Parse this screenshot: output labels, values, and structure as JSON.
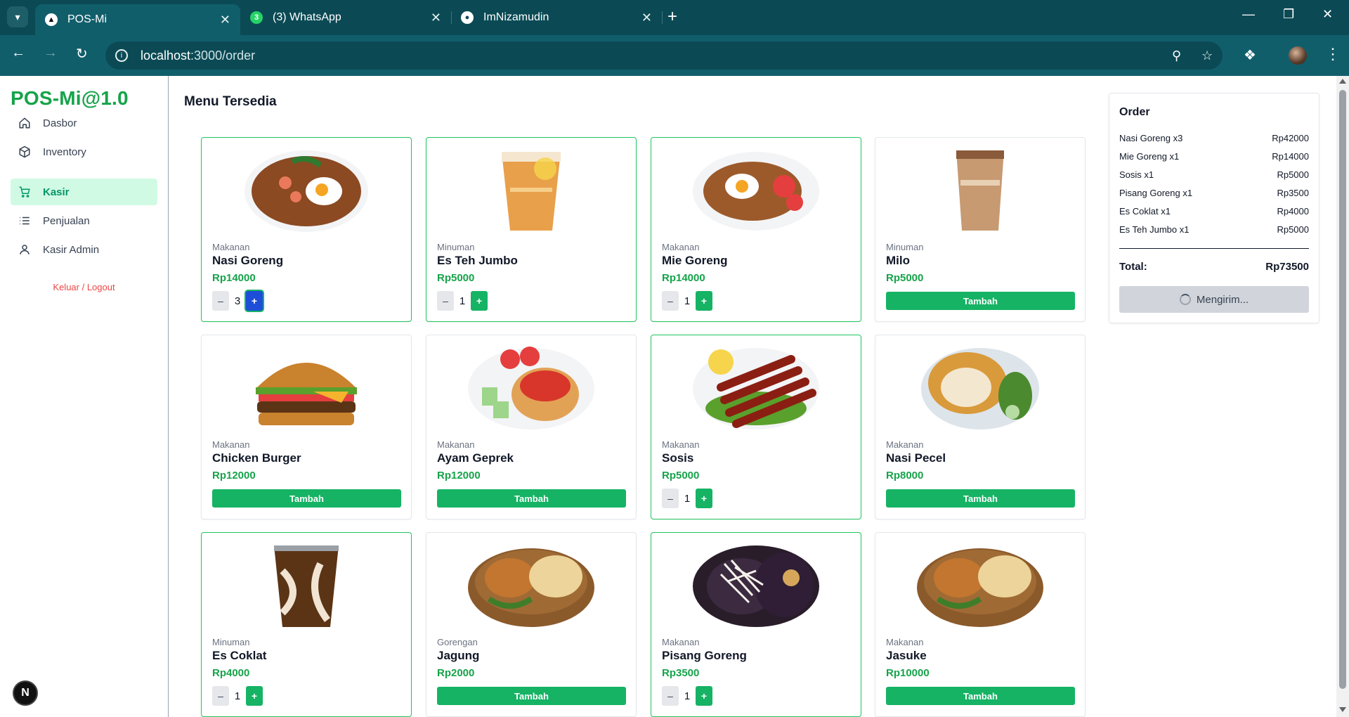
{
  "browser": {
    "tabs": [
      {
        "title": "POS-Mi",
        "icon": "nextjs-triangle-icon",
        "active": true
      },
      {
        "title": "(3) WhatsApp",
        "icon": "whatsapp-icon",
        "badge": "3",
        "active": false
      },
      {
        "title": "ImNizamudin",
        "icon": "github-icon",
        "active": false
      }
    ],
    "url_host": "localhost",
    "url_path": ":3000/order"
  },
  "sidebar": {
    "brand": "POS-Mi@1.0",
    "items": [
      {
        "label": "Dasbor",
        "icon": "home-icon",
        "active": false
      },
      {
        "label": "Inventory",
        "icon": "box-icon",
        "active": false
      },
      {
        "label": "Kasir",
        "icon": "cart-icon",
        "active": true
      },
      {
        "label": "Penjualan",
        "icon": "list-icon",
        "active": false
      },
      {
        "label": "Kasir Admin",
        "icon": "user-icon",
        "active": false
      }
    ],
    "logout": "Keluar / Logout",
    "dev_badge": "N"
  },
  "main": {
    "title": "Menu Tersedia",
    "add_label": "Tambah",
    "menu": [
      {
        "category": "Makanan",
        "name": "Nasi Goreng",
        "price": "Rp14000",
        "qty": "3",
        "selected": true,
        "img": "nasi-goreng"
      },
      {
        "category": "Minuman",
        "name": "Es Teh Jumbo",
        "price": "Rp5000",
        "qty": "1",
        "selected": true,
        "img": "es-teh"
      },
      {
        "category": "Makanan",
        "name": "Mie Goreng",
        "price": "Rp14000",
        "qty": "1",
        "selected": true,
        "img": "mie-goreng"
      },
      {
        "category": "Minuman",
        "name": "Milo",
        "price": "Rp5000",
        "qty": null,
        "selected": false,
        "img": "milo"
      },
      {
        "category": "Makanan",
        "name": "Chicken Burger",
        "price": "Rp12000",
        "qty": null,
        "selected": false,
        "img": "burger"
      },
      {
        "category": "Makanan",
        "name": "Ayam Geprek",
        "price": "Rp12000",
        "qty": null,
        "selected": false,
        "img": "ayam-geprek"
      },
      {
        "category": "Makanan",
        "name": "Sosis",
        "price": "Rp5000",
        "qty": "1",
        "selected": true,
        "img": "sosis"
      },
      {
        "category": "Makanan",
        "name": "Nasi Pecel",
        "price": "Rp8000",
        "qty": null,
        "selected": false,
        "img": "nasi-pecel"
      },
      {
        "category": "Minuman",
        "name": "Es Coklat",
        "price": "Rp4000",
        "qty": "1",
        "selected": true,
        "img": "es-coklat"
      },
      {
        "category": "Gorengan",
        "name": "Jagung",
        "price": "Rp2000",
        "qty": null,
        "selected": false,
        "img": "gorengan"
      },
      {
        "category": "Makanan",
        "name": "Pisang Goreng",
        "price": "Rp3500",
        "qty": "1",
        "selected": true,
        "img": "pisang-goreng"
      },
      {
        "category": "Makanan",
        "name": "Jasuke",
        "price": "Rp10000",
        "qty": null,
        "selected": false,
        "img": "gorengan"
      }
    ]
  },
  "order": {
    "title": "Order",
    "lines": [
      {
        "item": "Nasi Goreng x3",
        "amount": "Rp42000"
      },
      {
        "item": "Mie Goreng x1",
        "amount": "Rp14000"
      },
      {
        "item": "Sosis x1",
        "amount": "Rp5000"
      },
      {
        "item": "Pisang Goreng x1",
        "amount": "Rp3500"
      },
      {
        "item": "Es Coklat x1",
        "amount": "Rp4000"
      },
      {
        "item": "Es Teh Jumbo x1",
        "amount": "Rp5000"
      }
    ],
    "total_label": "Total:",
    "total_value": "Rp73500",
    "submit_label": "Mengirim..."
  },
  "colors": {
    "chrome": "#0b4a55",
    "accent": "#16b364",
    "brand": "#16a34a",
    "logout": "#ef4444"
  }
}
